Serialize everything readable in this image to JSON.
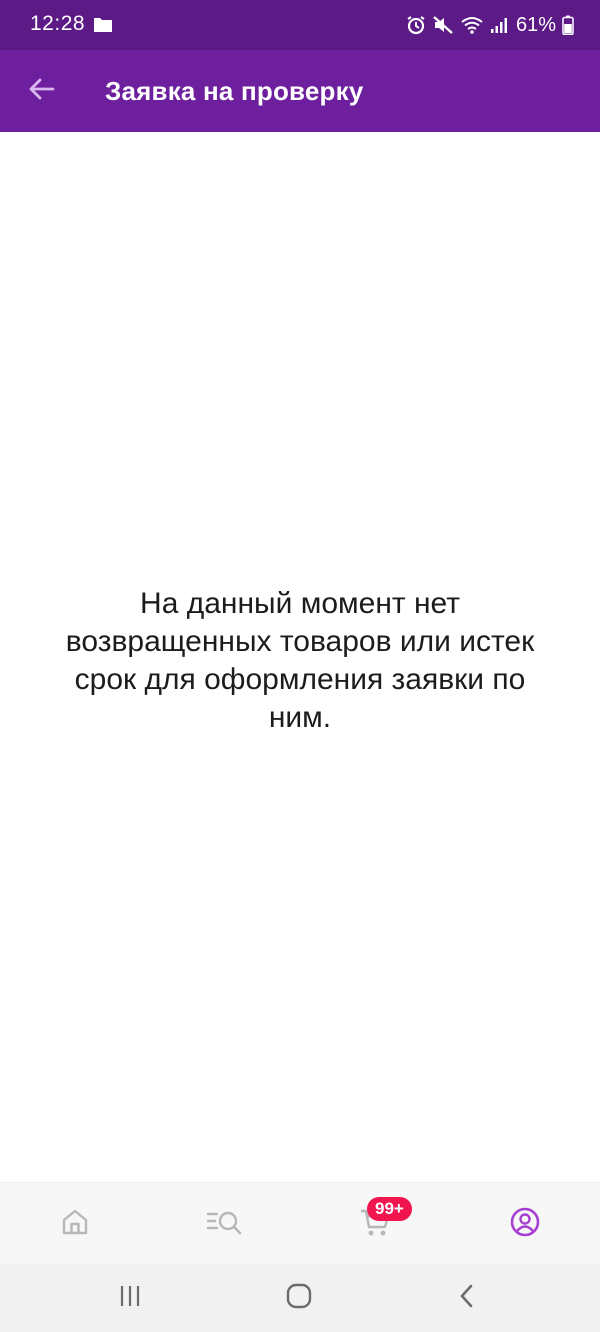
{
  "status_bar": {
    "time": "12:28",
    "battery_percent": "61%",
    "icons": [
      "folder-icon",
      "alarm-icon",
      "mute-icon",
      "wifi-icon",
      "signal-icon",
      "battery-icon"
    ]
  },
  "app_bar": {
    "title": "Заявка на проверку",
    "back_icon": "arrow-left-icon"
  },
  "main": {
    "empty_message": "На данный момент нет возвращенных товаров или истек срок для оформления заявки по ним."
  },
  "bottom_nav": {
    "items": [
      {
        "icon": "home-icon",
        "active": false
      },
      {
        "icon": "catalog-search-icon",
        "active": false
      },
      {
        "icon": "cart-icon",
        "active": false,
        "badge": "99+"
      },
      {
        "icon": "profile-icon",
        "active": true
      }
    ]
  },
  "system_nav": {
    "buttons": [
      "recents-icon",
      "home-button-icon",
      "back-icon"
    ]
  },
  "colors": {
    "status_bar": "#5b1a86",
    "app_bar": "#6e1f9e",
    "accent": "#a73fd1",
    "badge": "#f0154f",
    "nav_icon_inactive": "#b7b7b7"
  }
}
